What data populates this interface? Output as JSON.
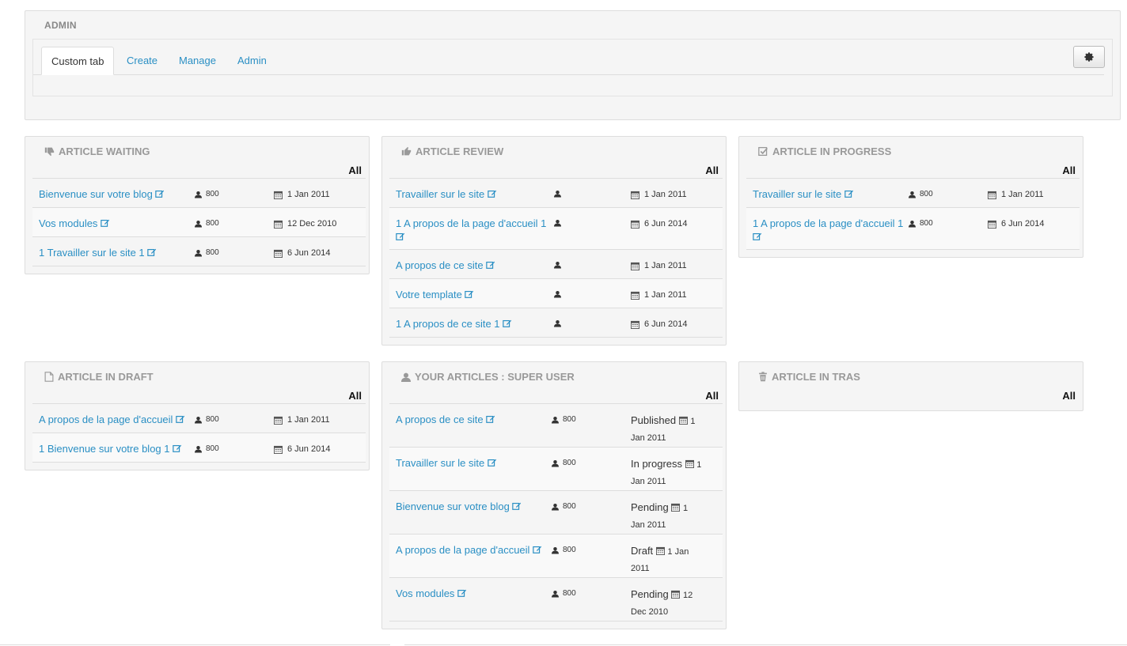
{
  "admin": {
    "title": "ADMIN",
    "tabs": [
      {
        "label": "Custom tab",
        "active": true
      },
      {
        "label": "Create",
        "active": false
      },
      {
        "label": "Manage",
        "active": false
      },
      {
        "label": "Admin",
        "active": false
      }
    ],
    "settings_icon": "gear-icon"
  },
  "colors": {
    "link": "#2a8fc4",
    "panel_bg": "#f5f5f5",
    "border": "#dddddd",
    "title_gray": "#999999"
  },
  "panels": {
    "waiting": {
      "title": "ARTICLE WAITING",
      "icon": "thumbs-down-icon",
      "all_label": "All",
      "rows": [
        {
          "title": "Bienvenue sur votre blog",
          "user": "800",
          "date": "1 Jan 2011"
        },
        {
          "title": "Vos modules",
          "user": "800",
          "date": "12 Dec 2010"
        },
        {
          "title": "1 Travailler sur le site 1",
          "user": "800",
          "date": "6 Jun 2014"
        }
      ]
    },
    "review": {
      "title": "ARTICLE REVIEW",
      "icon": "thumbs-up-icon",
      "all_label": "All",
      "rows": [
        {
          "title": "Travailler sur le site",
          "user": "",
          "date": "1 Jan 2011"
        },
        {
          "title": "1 A propos de la page d'accueil 1",
          "user": "",
          "date": "6 Jun 2014"
        },
        {
          "title": "A propos de ce site",
          "user": "",
          "date": "1 Jan 2011"
        },
        {
          "title": "Votre template",
          "user": "",
          "date": "1 Jan 2011"
        },
        {
          "title": "1 A propos de ce site 1",
          "user": "",
          "date": "6 Jun 2014"
        }
      ]
    },
    "progress": {
      "title": "ARTICLE IN PROGRESS",
      "icon": "check-square-icon",
      "all_label": "All",
      "rows": [
        {
          "title": "Travailler sur le site",
          "user": "800",
          "date": "1 Jan 2011"
        },
        {
          "title": "1 A propos de la page d'accueil 1",
          "user": "800",
          "date": "6 Jun 2014"
        }
      ]
    },
    "draft": {
      "title": "ARTICLE IN DRAFT",
      "icon": "file-icon",
      "all_label": "All",
      "rows": [
        {
          "title": "A propos de la page d'accueil",
          "user": "800",
          "date": "1 Jan 2011"
        },
        {
          "title": "1 Bienvenue sur votre blog 1",
          "user": "800",
          "date": "6 Jun 2014"
        }
      ]
    },
    "mine": {
      "title": "YOUR ARTICLES : SUPER USER",
      "icon": "user-icon",
      "all_label": "All",
      "rows": [
        {
          "title": "A propos de ce site",
          "user": "800",
          "status": "Published",
          "date_a": "1",
          "date_b": "Jan 2011"
        },
        {
          "title": "Travailler sur le site",
          "user": "800",
          "status": "In progress",
          "date_a": "1",
          "date_b": "Jan 2011"
        },
        {
          "title": "Bienvenue sur votre blog",
          "user": "800",
          "status": "Pending",
          "date_a": "1",
          "date_b": "Jan 2011"
        },
        {
          "title": "A propos de la page d'accueil",
          "user": "800",
          "status": "Draft",
          "date_a": "1 Jan",
          "date_b": "2011"
        },
        {
          "title": "Vos modules",
          "user": "800",
          "status": "Pending",
          "date_a": "12",
          "date_b": "Dec 2010"
        }
      ]
    },
    "trash": {
      "title": "ARTICLE IN TRAS",
      "icon": "trash-icon",
      "all_label": "All",
      "rows": []
    }
  }
}
